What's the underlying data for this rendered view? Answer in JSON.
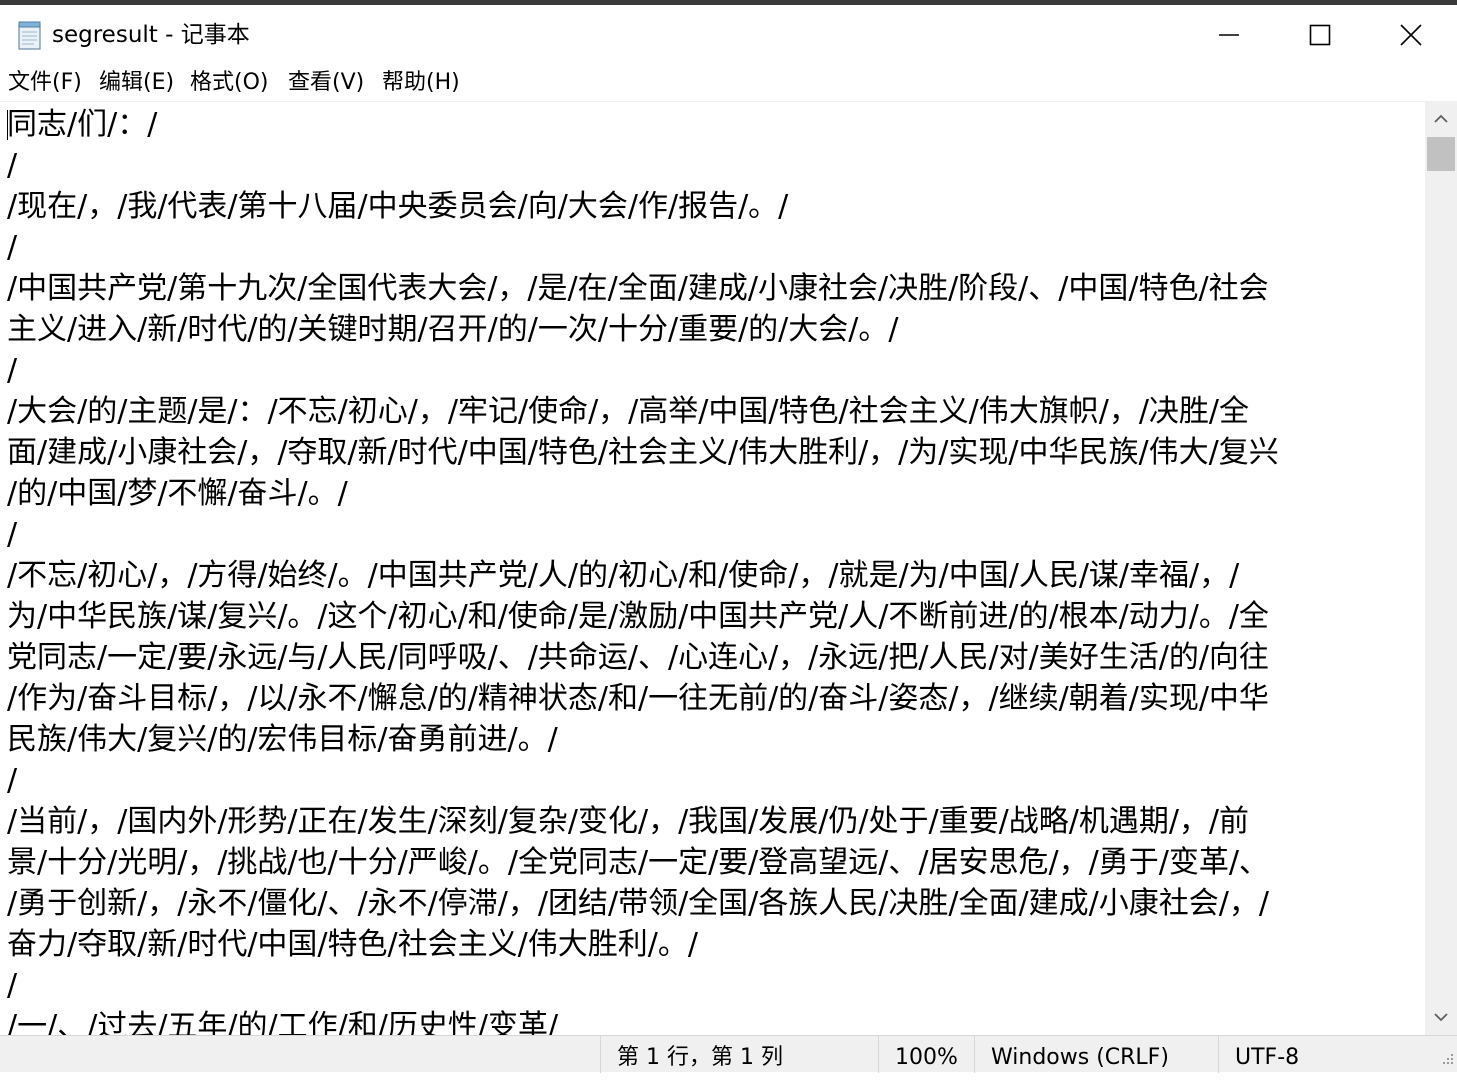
{
  "window": {
    "title": "segresult - 记事本",
    "app_icon": "notepad-icon",
    "controls": [
      "minimize-icon",
      "maximize-icon",
      "close-icon"
    ]
  },
  "menu": {
    "items": [
      {
        "label": "文件(F)"
      },
      {
        "label": "编辑(E)"
      },
      {
        "label": "格式(O)"
      },
      {
        "label": "查看(V)"
      },
      {
        "label": "帮助(H)"
      }
    ]
  },
  "editor": {
    "lines": [
      "同志/们/：/",
      "/",
      "/现在/，/我/代表/第十八届/中央委员会/向/大会/作/报告/。/",
      "/",
      "/中国共产党/第十九次/全国代表大会/，/是/在/全面/建成/小康社会/决胜/阶段/、/中国/特色/社会",
      "主义/进入/新/时代/的/关键时期/召开/的/一次/十分/重要/的/大会/。/",
      "/",
      "/大会/的/主题/是/：/不忘/初心/，/牢记/使命/，/高举/中国/特色/社会主义/伟大旗帜/，/决胜/全",
      "面/建成/小康社会/，/夺取/新/时代/中国/特色/社会主义/伟大胜利/，/为/实现/中华民族/伟大/复兴",
      "/的/中国/梦/不懈/奋斗/。/",
      "/",
      "/不忘/初心/，/方得/始终/。/中国共产党/人/的/初心/和/使命/，/就是/为/中国/人民/谋/幸福/，/",
      "为/中华民族/谋/复兴/。/这个/初心/和/使命/是/激励/中国共产党/人/不断前进/的/根本/动力/。/全",
      "党同志/一定/要/永远/与/人民/同呼吸/、/共命运/、/心连心/，/永远/把/人民/对/美好生活/的/向往",
      "/作为/奋斗目标/，/以/永不/懈怠/的/精神状态/和/一往无前/的/奋斗/姿态/，/继续/朝着/实现/中华",
      "民族/伟大/复兴/的/宏伟目标/奋勇前进/。/",
      "/",
      "/当前/，/国内外/形势/正在/发生/深刻/复杂/变化/，/我国/发展/仍/处于/重要/战略/机遇期/，/前",
      "景/十分/光明/，/挑战/也/十分/严峻/。/全党同志/一定/要/登高望远/、/居安思危/，/勇于/变革/、",
      "/勇于创新/，/永不/僵化/、/永不/停滞/，/团结/带领/全国/各族人民/决胜/全面/建成/小康社会/，/",
      "奋力/夺取/新/时代/中国/特色/社会主义/伟大胜利/。/",
      "/",
      "/一/、/过去/五年/的/工作/和/历史性/变革/"
    ]
  },
  "status": {
    "position": "第 1 行，第 1 列",
    "zoom": "100%",
    "line_ending": "Windows (CRLF)",
    "encoding": "UTF-8"
  }
}
